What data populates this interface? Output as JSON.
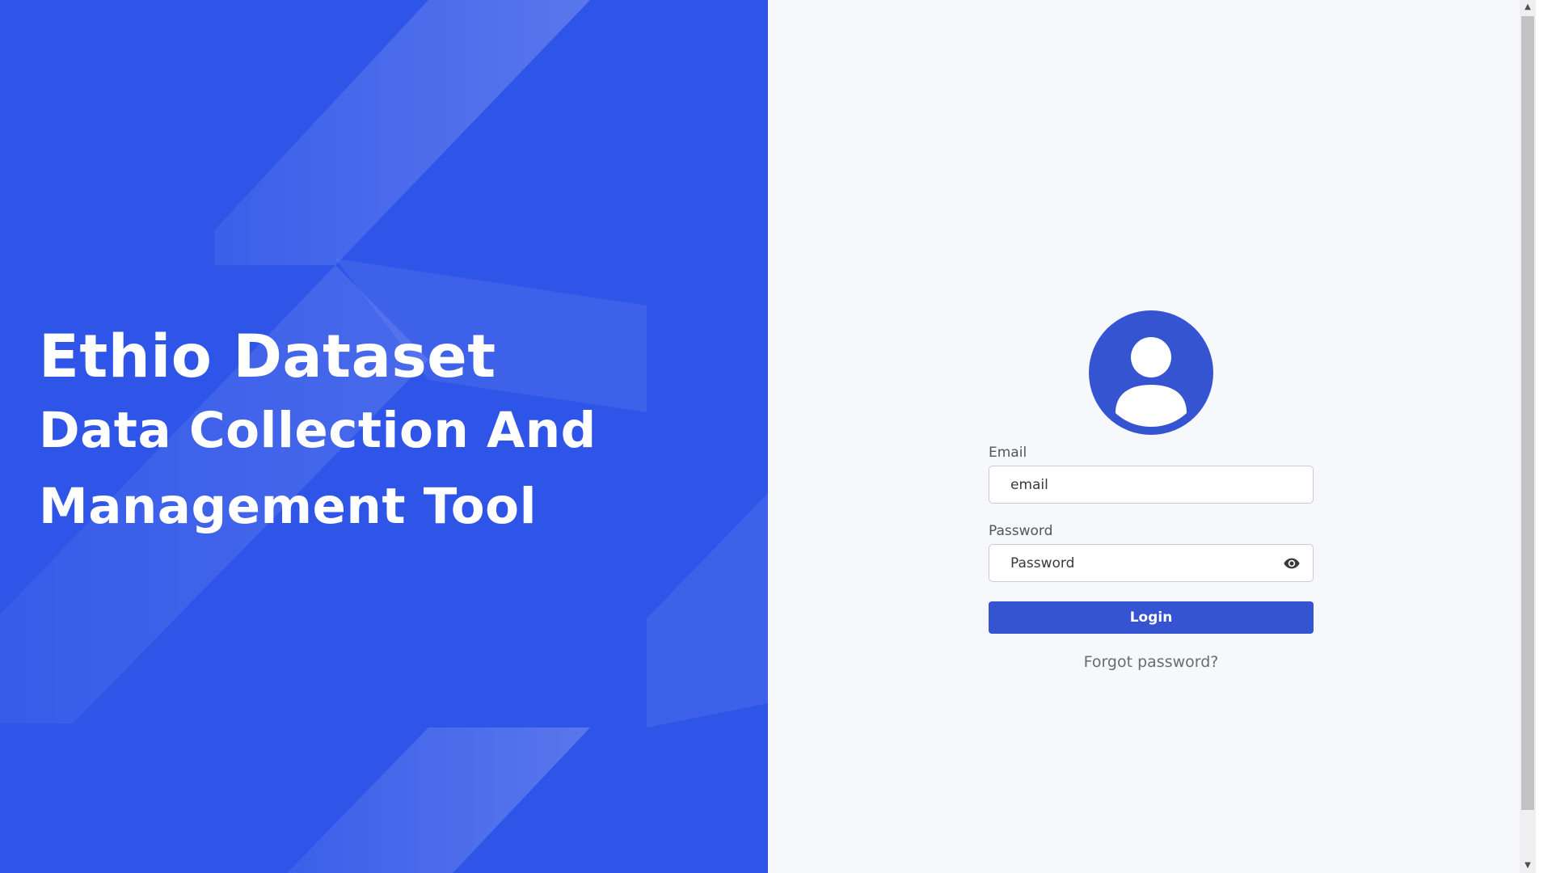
{
  "hero": {
    "title": "Ethio Dataset",
    "subtitle": "Data Collection And Management Tool",
    "background_color": "#2f55e8"
  },
  "login": {
    "avatar_icon": "user-circle-icon",
    "email_label": "Email",
    "email_placeholder": "email",
    "password_label": "Password",
    "password_placeholder": "Password",
    "password_toggle_icon": "eye-icon",
    "login_button_label": "Login",
    "forgot_password_label": "Forgot password?",
    "accent_color": "#3554d1",
    "panel_background": "#f6f8fc"
  },
  "scrollbar": {
    "up_icon": "arrow-up-icon",
    "down_icon": "arrow-down-icon"
  }
}
